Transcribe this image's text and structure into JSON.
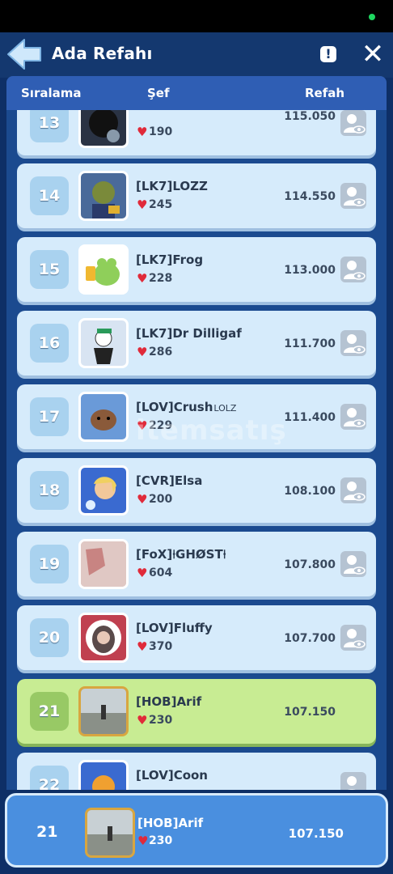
{
  "status_dot_color": "#1ed760",
  "header": {
    "title": "Ada Refahı",
    "info_label": "!",
    "close_label": "✕"
  },
  "columns": {
    "rank": "Sıralama",
    "chef": "Şef",
    "welfare": "Refah"
  },
  "rows": [
    {
      "rank": "13",
      "name": "",
      "likes": "190",
      "welfare": "115.050",
      "avatar_color": "#2a3344"
    },
    {
      "rank": "14",
      "name": "[LK7]LOZZ",
      "likes": "245",
      "welfare": "114.550",
      "avatar_color": "#4a6a9a"
    },
    {
      "rank": "15",
      "name": "[LK7]Frog",
      "likes": "228",
      "welfare": "113.000",
      "avatar_color": "#8fcf5a"
    },
    {
      "rank": "16",
      "name": "[LK7]Dr Dilligaf",
      "likes": "286",
      "welfare": "111.700",
      "avatar_color": "#d8e4f2"
    },
    {
      "rank": "17",
      "name": "[LOV]Crush",
      "name_suffix": "LOLZ",
      "likes": "229",
      "welfare": "111.400",
      "avatar_color": "#8a5a3a"
    },
    {
      "rank": "18",
      "name": "[CVR]Elsa",
      "likes": "200",
      "welfare": "108.100",
      "avatar_color": "#3a6ad0"
    },
    {
      "rank": "19",
      "name": "[FoX]⍿GHØST⍿",
      "likes": "604",
      "welfare": "107.800",
      "avatar_color": "#d9b8b4"
    },
    {
      "rank": "20",
      "name": "[LOV]Fluffy",
      "likes": "370",
      "welfare": "107.700",
      "avatar_color": "#7a5a5a"
    },
    {
      "rank": "21",
      "name": "[HOB]Arif",
      "likes": "230",
      "welfare": "107.150",
      "avatar_color": "#9aa5a8"
    },
    {
      "rank": "22",
      "name": "[LOV]Coon",
      "likes": "",
      "welfare": "",
      "avatar_color": "#3a6ad0"
    }
  ],
  "watermark": "itemsatış",
  "self": {
    "rank": "21",
    "name": "[HOB]Arif",
    "likes": "230",
    "welfare": "107.150"
  },
  "colors": {
    "header_bg": "#14386f",
    "row_bg": "#d6ebfb",
    "highlight_bg": "#c8ec93",
    "bottom_bar": "#4a8fdf",
    "heart": "#e02a3a"
  }
}
